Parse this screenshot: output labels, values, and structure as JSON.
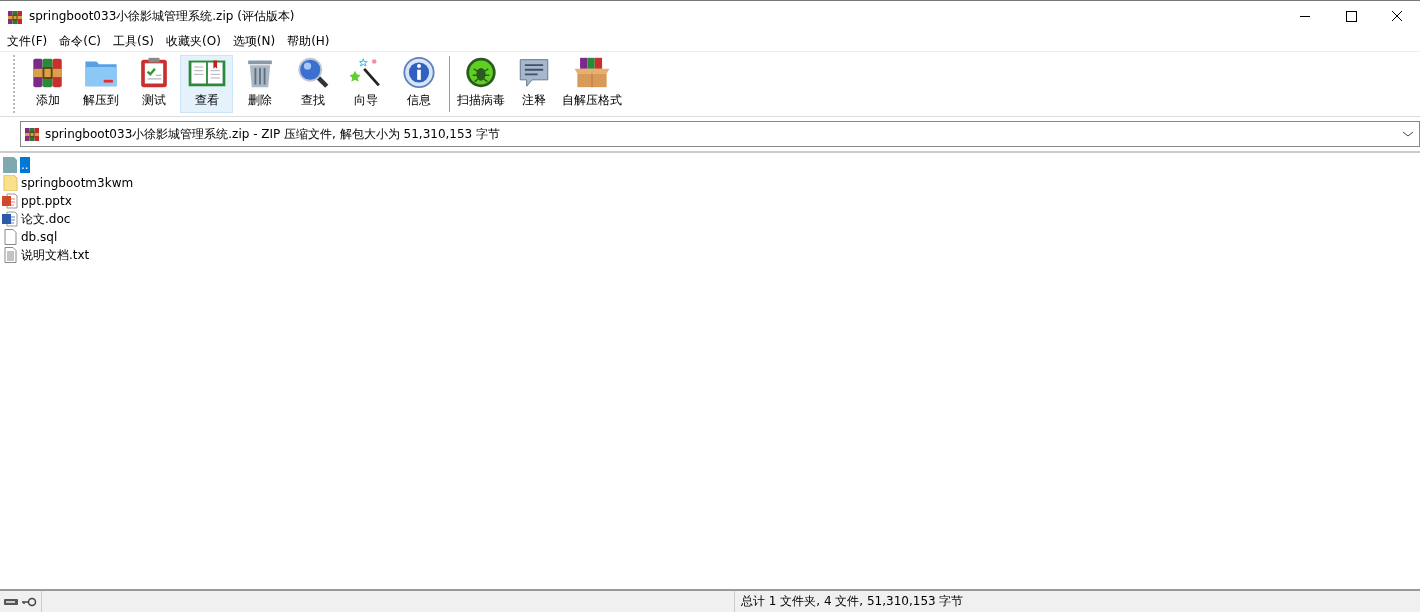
{
  "window": {
    "title": "springboot033小徐影城管理系统.zip (评估版本)"
  },
  "menu": [
    "文件(F)",
    "命令(C)",
    "工具(S)",
    "收藏夹(O)",
    "选项(N)",
    "帮助(H)"
  ],
  "toolbar": [
    {
      "label": "添加",
      "selected": false
    },
    {
      "label": "解压到",
      "selected": false
    },
    {
      "label": "测试",
      "selected": false
    },
    {
      "label": "查看",
      "selected": true
    },
    {
      "label": "删除",
      "selected": false
    },
    {
      "label": "查找",
      "selected": false
    },
    {
      "label": "向导",
      "selected": false
    },
    {
      "label": "信息",
      "selected": false
    },
    {
      "label": "扫描病毒",
      "selected": false
    },
    {
      "label": "注释",
      "selected": false
    },
    {
      "label": "自解压格式",
      "selected": false
    }
  ],
  "address": "springboot033小徐影城管理系统.zip - ZIP 压缩文件, 解包大小为 51,310,153 字节",
  "files": [
    {
      "name": "..",
      "kind": "parent",
      "selected": true
    },
    {
      "name": "springbootm3kwm",
      "kind": "folder",
      "selected": false
    },
    {
      "name": "ppt.pptx",
      "kind": "slides",
      "selected": false
    },
    {
      "name": "论文.doc",
      "kind": "word",
      "selected": false
    },
    {
      "name": "db.sql",
      "kind": "file",
      "selected": false
    },
    {
      "name": "说明文档.txt",
      "kind": "text",
      "selected": false
    }
  ],
  "status_bar": {
    "summary": "总计 1 文件夹, 4 文件, 51,310,153 字节"
  }
}
